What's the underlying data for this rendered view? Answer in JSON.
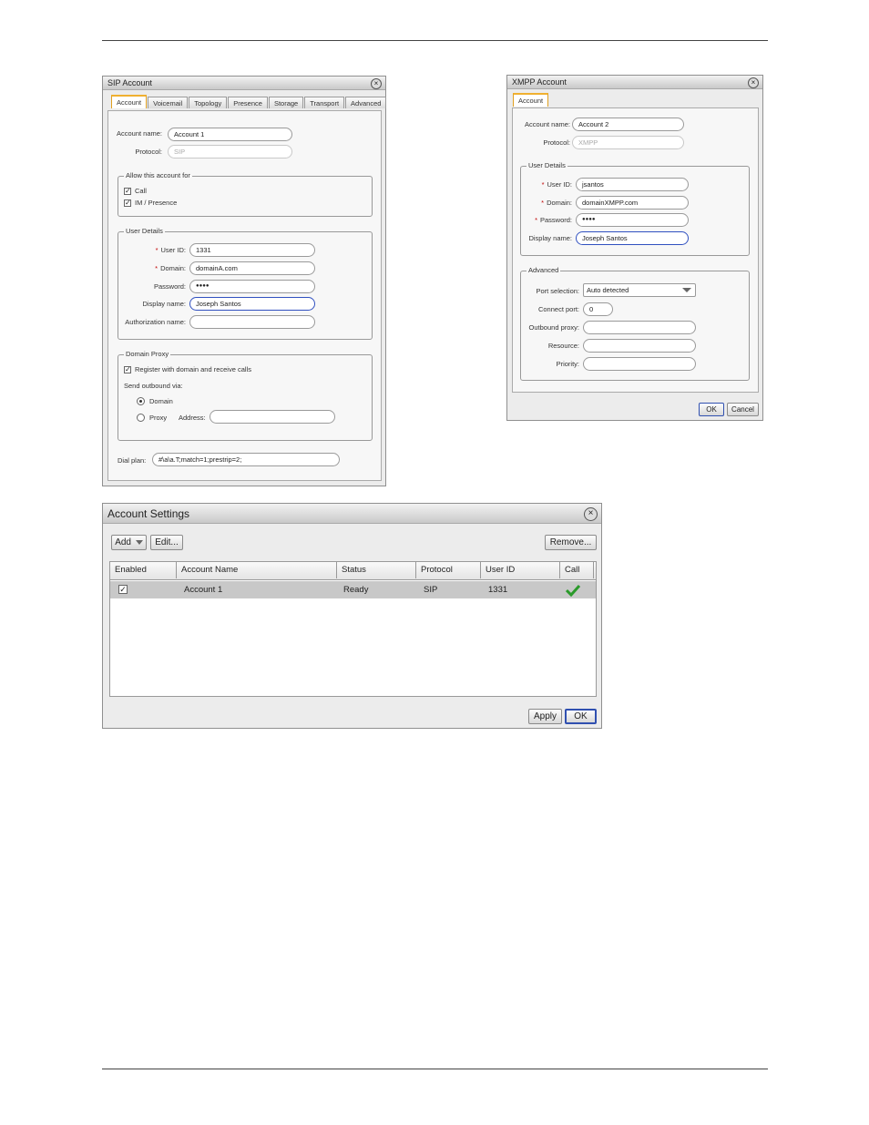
{
  "sip_account": {
    "title": "SIP Account",
    "tabs": [
      "Account",
      "Voicemail",
      "Topology",
      "Presence",
      "Storage",
      "Transport",
      "Advanced"
    ],
    "account_name_label": "Account name:",
    "account_name_value": "Account 1",
    "protocol_label": "Protocol:",
    "protocol_value": "SIP",
    "allow_group": {
      "title": "Allow this account for",
      "call_label": "Call",
      "im_label": "IM / Presence"
    },
    "user_details": {
      "title": "User Details",
      "user_id_label": "User ID:",
      "user_id_value": "1331",
      "domain_label": "Domain:",
      "domain_value": "domainA.com",
      "password_label": "Password:",
      "password_value": "●●●●",
      "display_name_label": "Display name:",
      "display_name_value": "Joseph Santos",
      "auth_name_label": "Authorization name:",
      "auth_name_value": ""
    },
    "domain_proxy": {
      "title": "Domain Proxy",
      "register_label": "Register with domain and receive calls",
      "send_outbound_label": "Send outbound via:",
      "domain_option": "Domain",
      "proxy_option": "Proxy",
      "address_label": "Address:",
      "address_value": ""
    },
    "dial_plan_label": "Dial plan:",
    "dial_plan_value": "#\\a\\a.T;match=1;prestrip=2;"
  },
  "xmpp_account": {
    "title": "XMPP Account",
    "tab": "Account",
    "account_name_label": "Account name:",
    "account_name_value": "Account 2",
    "protocol_label": "Protocol:",
    "protocol_value": "XMPP",
    "user_details": {
      "title": "User Details",
      "user_id_label": "User ID:",
      "user_id_value": "jsantos",
      "domain_label": "Domain:",
      "domain_value": "domainXMPP.com",
      "password_label": "Password:",
      "password_value": "●●●●",
      "display_name_label": "Display name:",
      "display_name_value": "Joseph Santos"
    },
    "advanced": {
      "title": "Advanced",
      "port_selection_label": "Port selection:",
      "port_selection_value": "Auto detected",
      "connect_port_label": "Connect port:",
      "connect_port_value": "0",
      "outbound_proxy_label": "Outbound proxy:",
      "resource_label": "Resource:",
      "priority_label": "Priority:"
    },
    "ok_label": "OK",
    "cancel_label": "Cancel"
  },
  "account_settings": {
    "title": "Account Settings",
    "add_label": "Add",
    "edit_label": "Edit...",
    "remove_label": "Remove...",
    "columns": [
      "Enabled",
      "Account Name",
      "Status",
      "Protocol",
      "User ID",
      "Call"
    ],
    "rows": [
      {
        "account_name": "Account 1",
        "status": "Ready",
        "protocol": "SIP",
        "user_id": "1331"
      }
    ],
    "apply_label": "Apply",
    "ok_label": "OK"
  }
}
